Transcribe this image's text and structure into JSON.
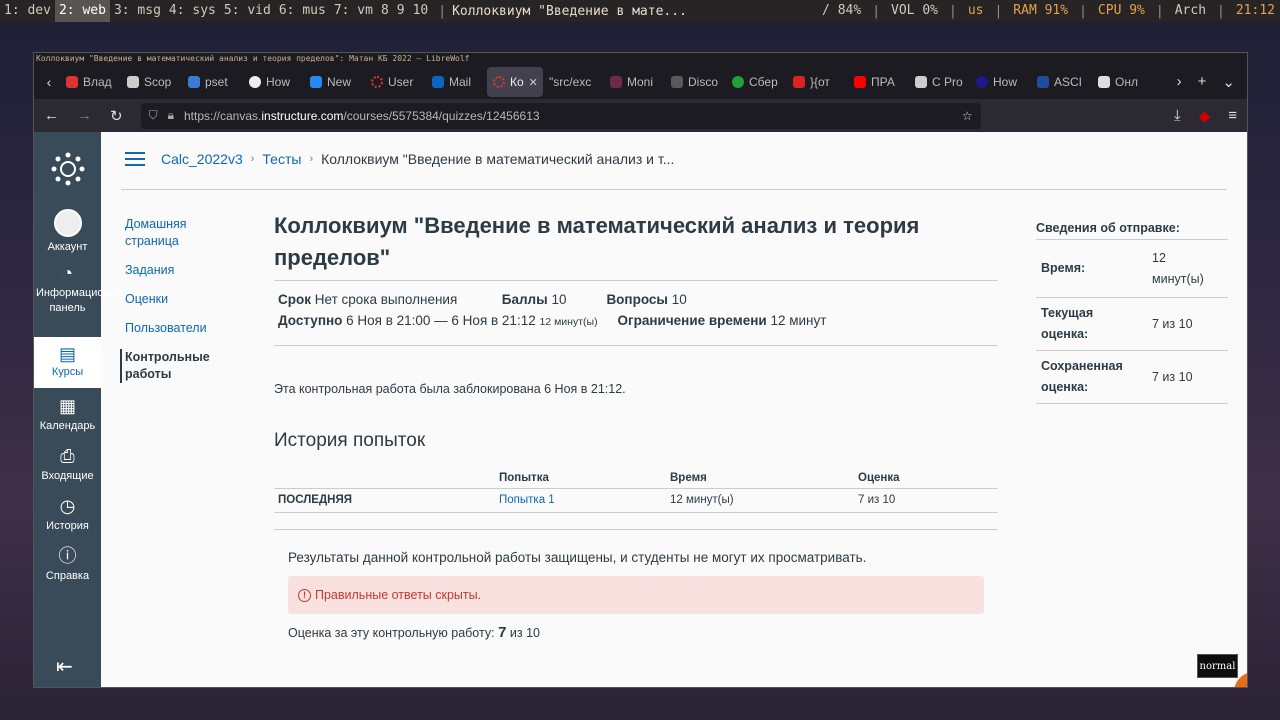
{
  "wm": {
    "workspaces": [
      "1: dev",
      "2: web",
      "3: msg",
      "4: sys",
      "5: vid",
      "6: mus",
      "7: vm",
      "8",
      "9",
      "10"
    ],
    "active_ws": "2: web",
    "window_title": "Коллоквиум \"Введение в мате...",
    "bright": "/ 84%",
    "vol": "VOL 0%",
    "layout": "us",
    "ram": "RAM 91%",
    "cpu": "CPU  9%",
    "os": "Arch",
    "clock": "21:12"
  },
  "browser": {
    "title": "Коллоквиум \"Введение в математический анализ и теория пределов\": Матан КБ 2022 — LibreWolf",
    "tabs": [
      "Влад",
      "Scop",
      "pset",
      "How",
      "New",
      "User",
      "Mail",
      "Ко",
      "\"src/exc",
      "Moni",
      "Disco",
      "Сбер",
      "}{от",
      "ПРА",
      "C Pro",
      "How",
      "ASCI",
      "Онл"
    ],
    "url_prefix": "https://canvas.",
    "url_domain": "instructure.com",
    "url_path": "/courses/5575384/quizzes/12456613"
  },
  "gnav": {
    "account": "Аккаунт",
    "dashboard": "Информационная панель",
    "courses": "Курсы",
    "calendar": "Календарь",
    "inbox": "Входящие",
    "history": "История",
    "help": "Справка"
  },
  "crumbs": {
    "course": "Calc_2022v3",
    "quizzes": "Тесты",
    "current": "Коллоквиум \"Введение в математический анализ и т..."
  },
  "cnav": [
    "Домашняя страница",
    "Задания",
    "Оценки",
    "Пользователи",
    "Контрольные работы"
  ],
  "quiz": {
    "title": "Коллоквиум \"Введение в математический анализ и теория пределов\"",
    "due_label": "Срок",
    "due": "Нет срока выполнения",
    "points_label": "Баллы",
    "points": "10",
    "questions_label": "Вопросы",
    "questions": "10",
    "avail_label": "Доступно",
    "avail": "6 Ноя в 21:00 — 6 Ноя в 21:12",
    "avail_dur": "12 минут(ы)",
    "limit_label": "Ограничение времени",
    "limit": "12 минут",
    "locked": "Эта контрольная работа была заблокирована 6 Ноя в 21:12.",
    "history_title": "История попыток",
    "table_headers": [
      "",
      "Попытка",
      "Время",
      "Оценка"
    ],
    "row": [
      "ПОСЛЕДНЯЯ",
      "Попытка 1",
      "12 минут(ы)",
      "7 из 10"
    ],
    "protected": "Результаты данной контрольной работы защищены, и студенты не могут их просматривать.",
    "alert": "Правильные ответы скрыты.",
    "score_label": "Оценка за эту контрольную работу:",
    "score_val": "7",
    "score_of": "из 10"
  },
  "side": {
    "heading": "Сведения об отправке:",
    "time_label": "Время:",
    "time": "12 минут(ы)",
    "cur_label": "Текущая оценка:",
    "cur": "7 из 10",
    "saved_label": "Сохраненная оценка:",
    "saved": "7 из 10"
  },
  "mode": "normal"
}
